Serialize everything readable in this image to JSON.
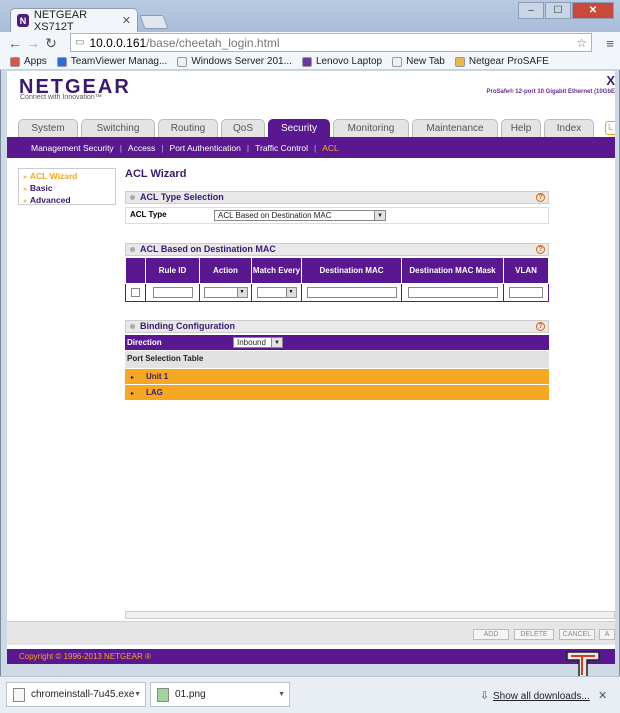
{
  "browser": {
    "tab_title": "NETGEAR XS712T",
    "tab_favicon": "N",
    "url_host": "10.0.0.161",
    "url_path": "/base/cheetah_login.html",
    "bookmarks": [
      {
        "label": "Apps",
        "color": "#d9534f"
      },
      {
        "label": "TeamViewer Manag...",
        "color": "#2a6fd8"
      },
      {
        "label": "Windows Server 201...",
        "color": "#f0f0f0"
      },
      {
        "label": "Lenovo Laptop",
        "color": "#6a3aa0"
      },
      {
        "label": "New Tab",
        "color": "#f0f0f0"
      },
      {
        "label": "Netgear ProSAFE",
        "color": "#e8b84a"
      }
    ]
  },
  "brand": {
    "logo": "NETGEAR",
    "tagline": "Connect with Innovation™",
    "product_x": "X",
    "product_desc": "ProSafe® 12-port 10 Gigabit Ethernet (10GbE"
  },
  "main_tabs": [
    {
      "label": "System",
      "w": 0
    },
    {
      "label": "Switching"
    },
    {
      "label": "Routing"
    },
    {
      "label": "QoS"
    },
    {
      "label": "Security"
    },
    {
      "label": "Monitoring"
    },
    {
      "label": "Maintenance"
    },
    {
      "label": "Help"
    },
    {
      "label": "Index"
    }
  ],
  "sub_nav": [
    "Management Security",
    "Access",
    "Port Authentication",
    "Traffic Control",
    "ACL"
  ],
  "left_nav": [
    "ACL Wizard",
    "Basic",
    "Advanced"
  ],
  "page_title": "ACL Wizard",
  "acl_type_section": {
    "title": "ACL Type Selection",
    "label": "ACL Type",
    "value": "ACL Based on Destination MAC"
  },
  "rules_section": {
    "title": "ACL Based on Destination MAC",
    "columns": [
      "Rule ID",
      "Action",
      "Match Every",
      "Destination MAC",
      "Destination MAC Mask",
      "VLAN"
    ]
  },
  "binding_section": {
    "title": "Binding Configuration",
    "direction_label": "Direction",
    "direction_value": "Inbound",
    "port_table_label": "Port Selection Table",
    "groups": [
      "Unit 1",
      "LAG"
    ]
  },
  "buttons": {
    "add": "ADD",
    "delete": "DELETE",
    "cancel": "CANCEL",
    "apply": "A"
  },
  "copyright": "Copyright © 1996-2013 NETGEAR ®",
  "downloads": {
    "items": [
      "chromeinstall-7u45.exe",
      "01.png"
    ],
    "show_all": "Show all downloads..."
  },
  "help_glyph": "?"
}
